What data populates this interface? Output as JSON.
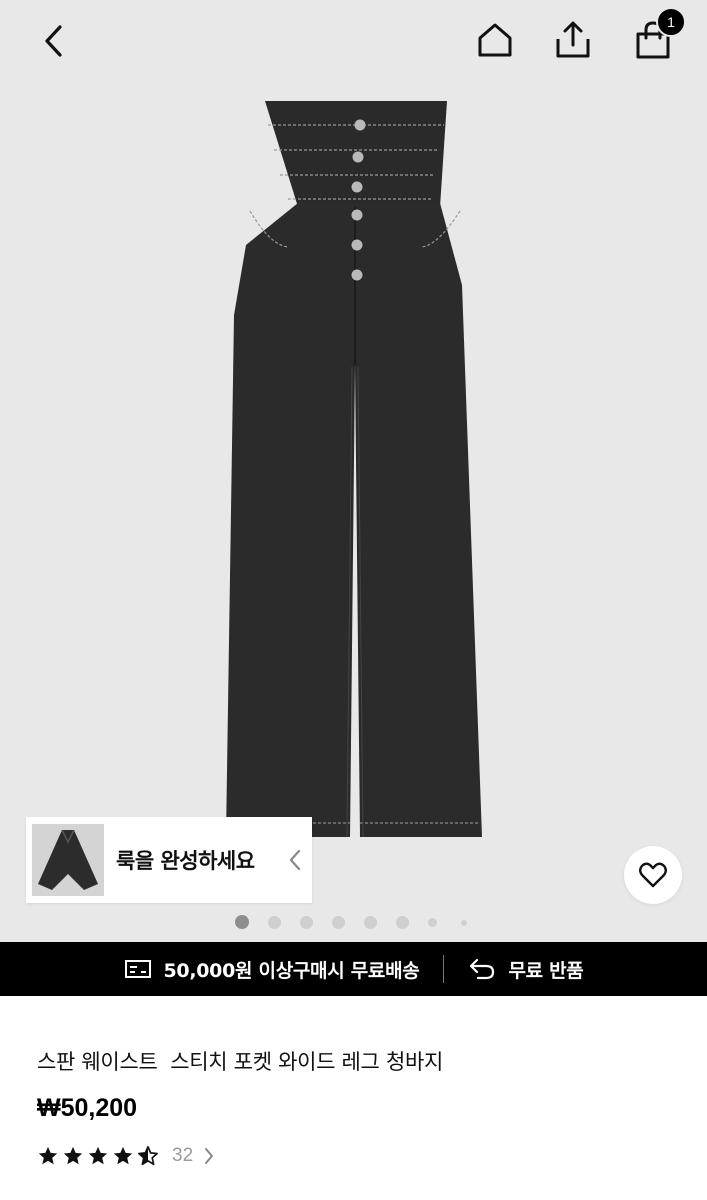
{
  "header": {
    "back_icon": "chevron-left-icon",
    "home_icon": "home-icon",
    "share_icon": "share-icon",
    "cart_icon": "shopping-bag-icon",
    "cart_badge": "1"
  },
  "gallery": {
    "image_subject": "black high-waist wide-leg jeans",
    "total_dots": 8,
    "active_index": 0
  },
  "look_card": {
    "label": "룩을 완성하세요",
    "chevron_icon": "chevron-left-icon"
  },
  "wishlist": {
    "icon": "heart-icon"
  },
  "promo": {
    "shipping_icon": "delivery-card-icon",
    "shipping_text": "50,000원 이상구매시 무료배송",
    "return_icon": "return-arrow-icon",
    "return_text": "무료 반품"
  },
  "product": {
    "title": "스판 웨이스트  스티치 포켓 와이드 레그 청바지",
    "price": "₩50,200",
    "rating": 4.5,
    "review_count": "32"
  },
  "colors": {
    "hero_bg": "#e8e8e8",
    "promo_bg": "#000000",
    "accent": "#000000"
  }
}
